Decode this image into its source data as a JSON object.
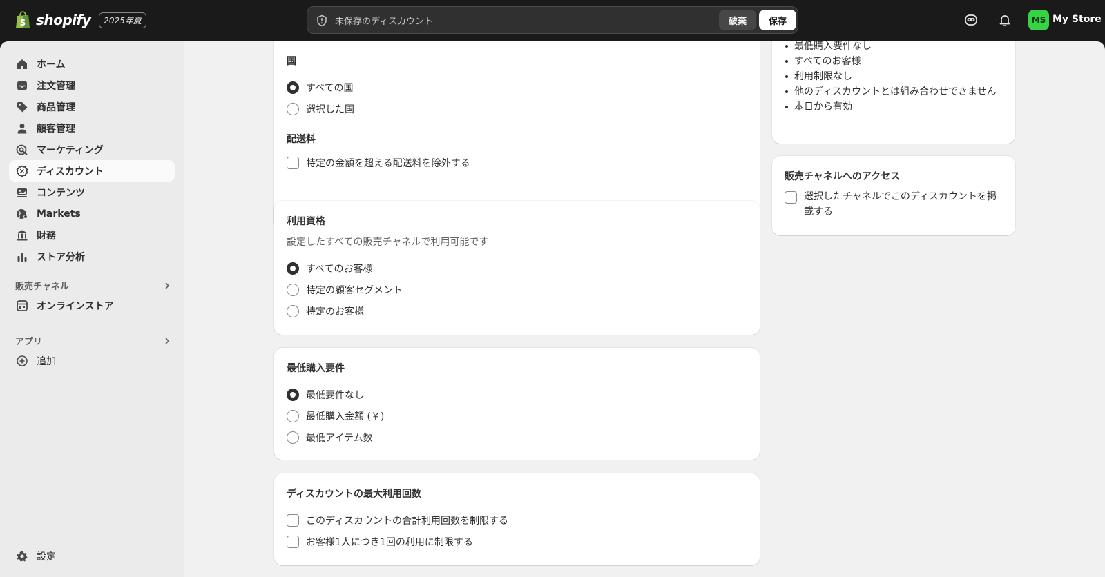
{
  "brand": {
    "name": "shopify",
    "badge": "2025年夏"
  },
  "savebar": {
    "message": "未保存のディスカウント",
    "discard_label": "破棄",
    "save_label": "保存"
  },
  "account": {
    "initials": "MS",
    "store_name": "My Store"
  },
  "nav": {
    "items": [
      {
        "label": "ホーム",
        "icon": "home-icon"
      },
      {
        "label": "注文管理",
        "icon": "inbox-icon"
      },
      {
        "label": "商品管理",
        "icon": "tag-icon"
      },
      {
        "label": "顧客管理",
        "icon": "person-icon"
      },
      {
        "label": "マーケティング",
        "icon": "target-icon"
      },
      {
        "label": "ディスカウント",
        "icon": "discount-icon"
      },
      {
        "label": "コンテンツ",
        "icon": "content-icon"
      },
      {
        "label": "Markets",
        "icon": "globe-icon"
      },
      {
        "label": "財務",
        "icon": "bank-icon"
      },
      {
        "label": "ストア分析",
        "icon": "chart-icon"
      }
    ],
    "sales_channels_label": "販売チャネル",
    "online_store_label": "オンラインストア",
    "apps_label": "アプリ",
    "add_label": "追加",
    "settings_label": "設定"
  },
  "country_card": {
    "country_title": "国",
    "options": [
      "すべての国",
      "選択した国"
    ],
    "shipping_title": "配送料",
    "shipping_option": "特定の金額を超える配送料を除外する"
  },
  "eligibility_card": {
    "title": "利用資格",
    "subtitle": "設定したすべての販売チャネルで利用可能です",
    "options": [
      "すべてのお客様",
      "特定の顧客セグメント",
      "特定のお客様"
    ]
  },
  "min_req_card": {
    "title": "最低購入要件",
    "options": [
      "最低要件なし",
      "最低購入金額 (￥)",
      "最低アイテム数"
    ]
  },
  "max_uses_card": {
    "title": "ディスカウントの最大利用回数",
    "options": [
      "このディスカウントの合計利用回数を制限する",
      "お客様1人につき1回の利用に制限する"
    ]
  },
  "summary": {
    "items": [
      "最低購入要件なし",
      "すべてのお客様",
      "利用制限なし",
      "他のディスカウントとは組み合わせできません",
      "本日から有効"
    ]
  },
  "channel_card": {
    "title": "販売チャネルへのアクセス",
    "option": "選択したチャネルでこのディスカウントを掲載する"
  }
}
